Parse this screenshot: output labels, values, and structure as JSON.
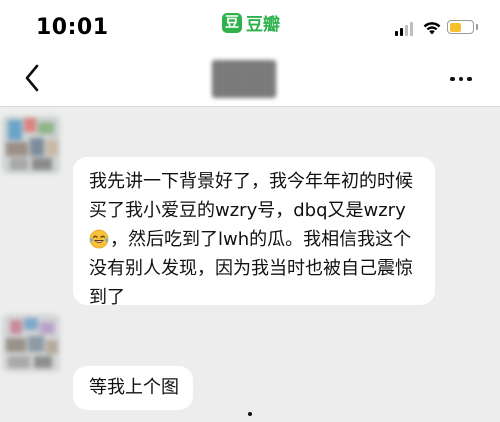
{
  "status_bar": {
    "time": "10:01",
    "app_icon_glyph": "豆",
    "app_name": "豆瓣",
    "app_color": "#2fb24c",
    "battery_color": "#f6c12a",
    "battery_level": 0.5,
    "icons": [
      "signal-icon",
      "wifi-icon",
      "battery-icon"
    ]
  },
  "nav_bar": {
    "back_icon": "chevron-left-icon",
    "more_icon": "more-horizontal-icon"
  },
  "messages": [
    {
      "sender": "other",
      "lines": [
        "我先讲一下背景好了，我今年年初的时候",
        "买了我小爱豆的wzry号，dbq又是wzry",
        "，然后吃到了lwh的瓜。我相信我这个",
        "没有别人发现，因为我当时也被自己震惊",
        "到了"
      ],
      "inline_emoji": "tears-of-joy-emoji"
    },
    {
      "sender": "other",
      "text": "等我上个图"
    }
  ]
}
